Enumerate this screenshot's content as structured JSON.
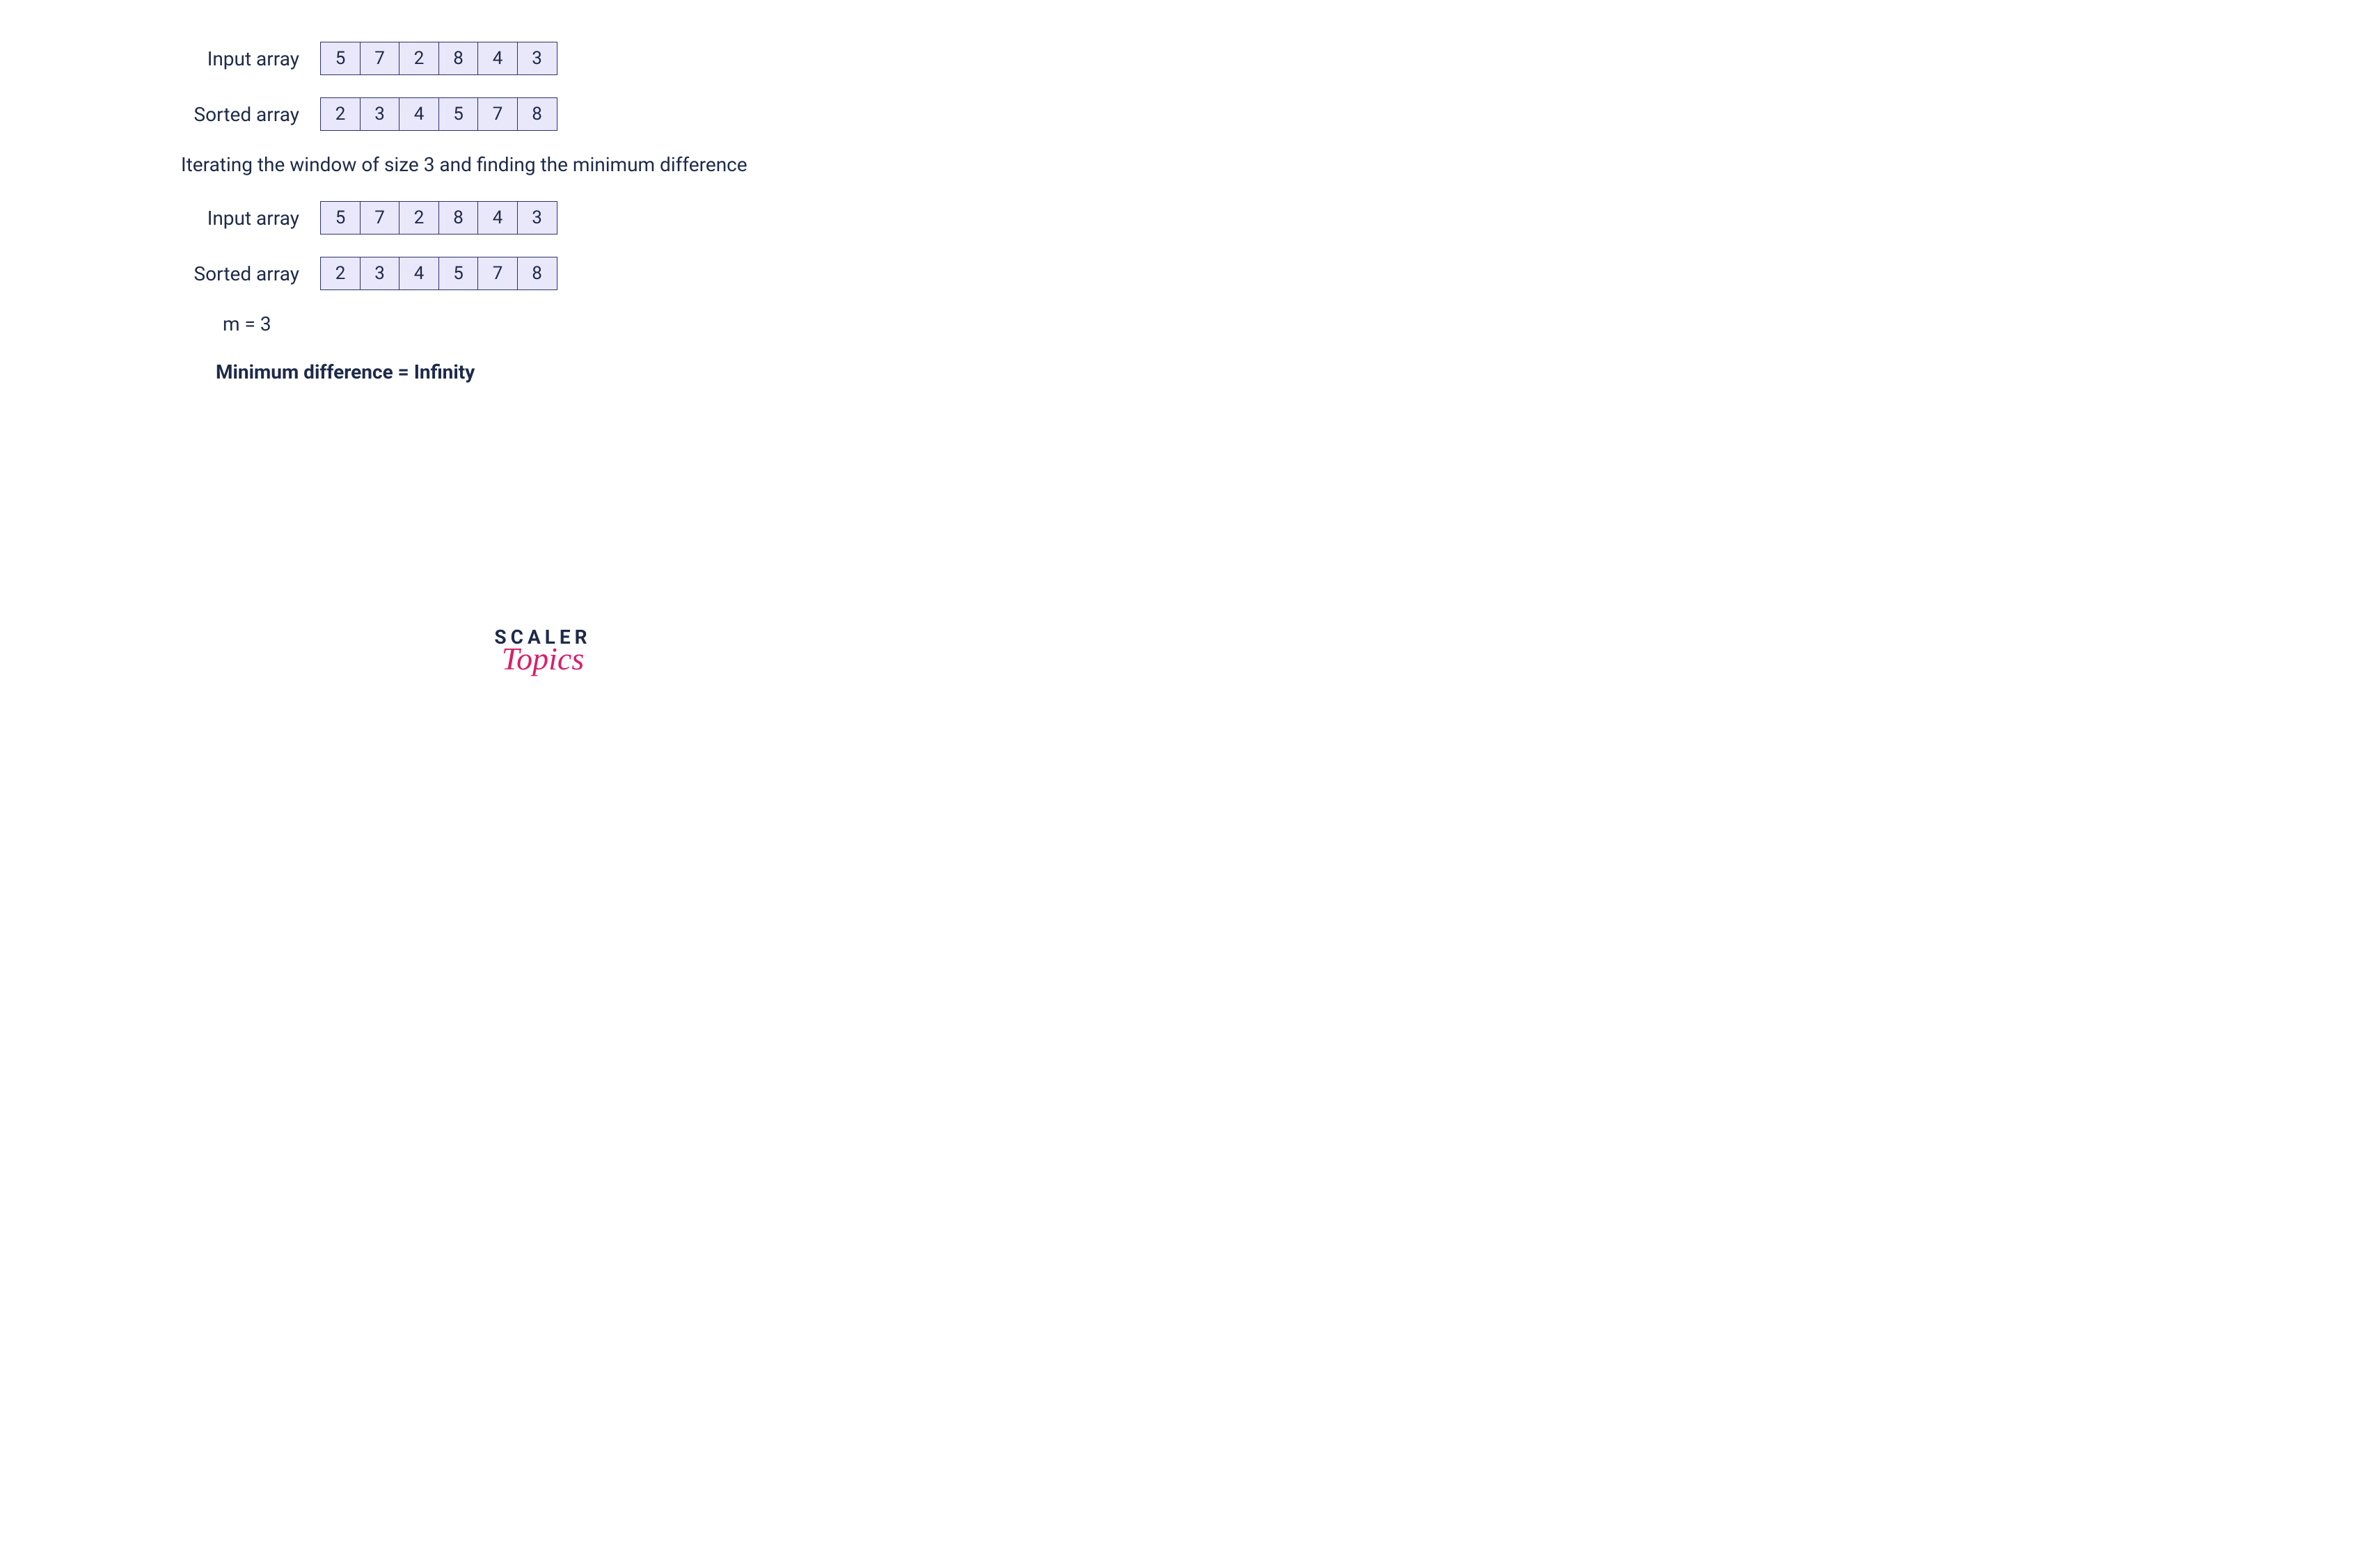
{
  "rows": [
    {
      "label": "Input array",
      "values": [
        5,
        7,
        2,
        8,
        4,
        3
      ]
    },
    {
      "label": "Sorted array",
      "values": [
        2,
        3,
        4,
        5,
        7,
        8
      ]
    }
  ],
  "caption": "Iterating the window of size 3 and finding the minimum difference",
  "rows2": [
    {
      "label": "Input array",
      "values": [
        5,
        7,
        2,
        8,
        4,
        3
      ]
    },
    {
      "label": "Sorted array",
      "values": [
        2,
        3,
        4,
        5,
        7,
        8
      ]
    }
  ],
  "m_line": "m = 3",
  "mindiff": "Minimum difference = Infinity",
  "logo": {
    "scaler": "SCALER",
    "topics": "Topics"
  }
}
